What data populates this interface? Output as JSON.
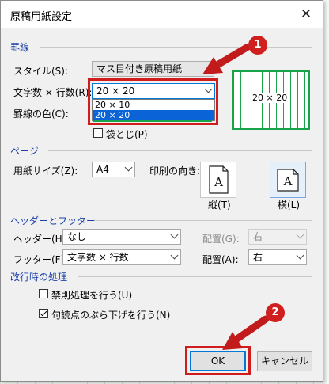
{
  "dialog": {
    "title": "原稿用紙設定",
    "close_glyph": "✕"
  },
  "sections": {
    "rule": "罫線",
    "page": "ページ",
    "header_footer": "ヘッダーとフッター",
    "line_break": "改行時の処理"
  },
  "rule": {
    "style_label": "スタイル(S):",
    "style_value": "マス目付き原稿用紙",
    "chars_label": "文字数 × 行数(R):",
    "chars_value": "20 × 20",
    "color_label": "罫線の色(C):",
    "fold_label": "袋とじ(P)",
    "fold_checked": false,
    "dropdown_options": [
      "20 × 10",
      "20 × 20"
    ],
    "dropdown_selected": "20 × 20",
    "preview_text": "20 × 20",
    "rule_color": "#18a24a"
  },
  "page": {
    "paper_label": "用紙サイズ(Z):",
    "paper_value": "A4",
    "orientation_label": "印刷の向き:",
    "portrait_label": "縦(T)",
    "landscape_label": "横(L)",
    "orientation_glyph": "A",
    "selected_orientation": "landscape"
  },
  "header_footer": {
    "header_label": "ヘッダー(H):",
    "header_value": "なし",
    "header_pos_label": "配置(G):",
    "header_pos_value": "右",
    "footer_label": "フッター(F):",
    "footer_value": "文字数 × 行数",
    "footer_pos_label": "配置(A):",
    "footer_pos_value": "右"
  },
  "line_break": {
    "kinsoku_label": "禁則処理を行う(U)",
    "kinsoku_checked": false,
    "punct_label": "句読点のぶら下げを行う(N)",
    "punct_checked": true
  },
  "buttons": {
    "ok": "OK",
    "cancel": "キャンセル"
  },
  "annotations": {
    "step1": "1",
    "step2": "2",
    "arrow_color": "#c21b1b",
    "highlight_color": "#d01c1c"
  }
}
